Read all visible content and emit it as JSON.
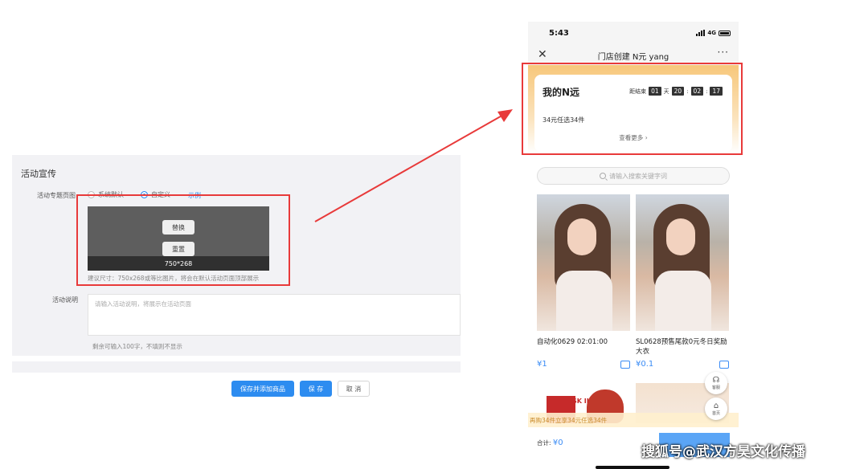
{
  "admin": {
    "section_title": "活动宣传",
    "banner_row_label": "活动专题页图",
    "radio_default": "系统默认",
    "radio_custom": "自定义",
    "example_link": "示例",
    "replace_button": "替换",
    "reset_button": "重置",
    "image_size": "750*268",
    "size_hint": "建议尺寸：750x268或等比图片，将会在默认活动页面顶部展示",
    "desc_label": "活动说明",
    "desc_placeholder": "请输入活动说明，将展示在活动页面",
    "desc_hint": "剩余可输入100字，不填则不显示",
    "buttons": {
      "save_add": "保存并添加商品",
      "save": "保 存",
      "cancel": "取 消"
    }
  },
  "phone": {
    "time": "5:43",
    "network": "4G",
    "title": "门店创建 N元 yang",
    "card": {
      "title": "我的N远",
      "countdown_label": "距结束",
      "days": "01",
      "day_unit": "天",
      "hours": "20",
      "minutes": "02",
      "seconds": "17",
      "subtitle": "34元任选34件",
      "more": "查看更多"
    },
    "search_placeholder": "请输入搜索关键字词",
    "products": [
      {
        "name": "自动化0629 02:01:00",
        "price": "¥1"
      },
      {
        "name": "SL0628预售尾款0元冬日奖励大衣",
        "price": "¥0.1"
      }
    ],
    "thumb_brand": "SK II",
    "promo": "再购34件立享34元任选34件",
    "service_label": "客服",
    "home_label": "首页",
    "total_label": "合计:",
    "total_value": "¥0"
  },
  "watermark": "搜狐号@武汉方昊文化传播",
  "colors": {
    "primary": "#2d8cf0",
    "annotation": "#e83a3a",
    "price": "#3b8cf5"
  }
}
